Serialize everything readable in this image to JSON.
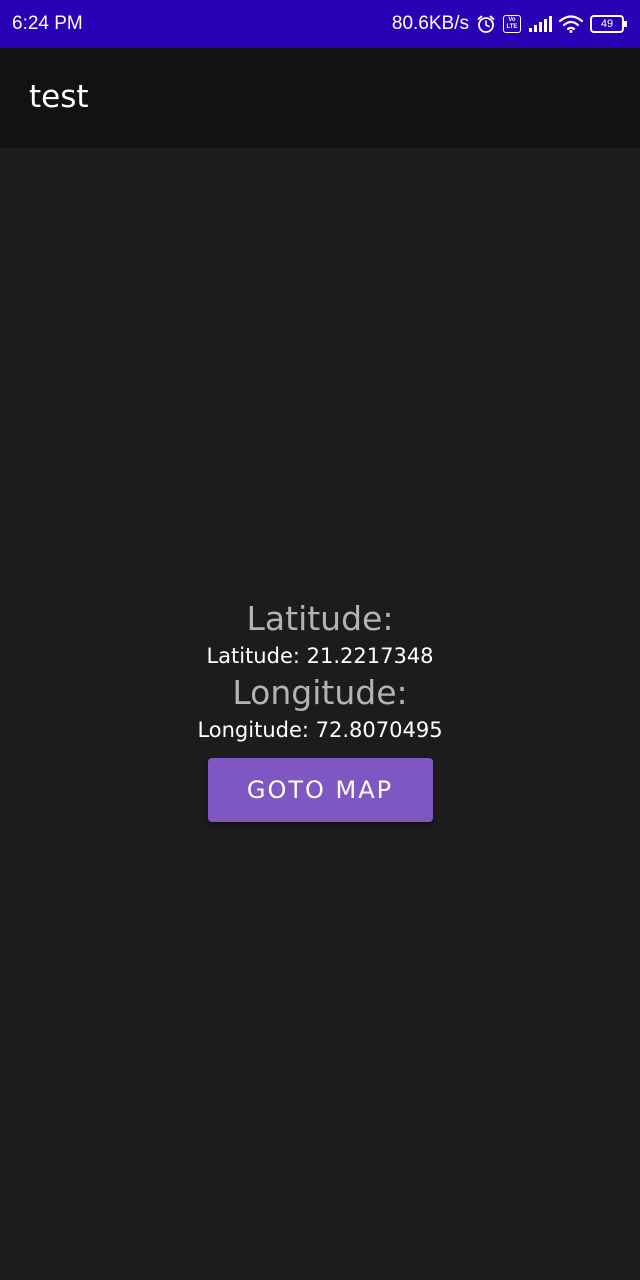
{
  "status_bar": {
    "time": "6:24 PM",
    "network_speed": "80.6KB/s",
    "volte_top": "Vo",
    "volte_bottom": "LTE",
    "battery_level": "49",
    "icons": [
      "alarm-icon",
      "volte-icon",
      "signal-icon",
      "wifi-icon",
      "battery-icon"
    ]
  },
  "app_bar": {
    "title": "test"
  },
  "main": {
    "latitude_heading": "Latitude:",
    "latitude_value": "Latitude: 21.2217348",
    "longitude_heading": "Longitude:",
    "longitude_value": "Longitude: 72.8070495",
    "goto_button_label": "GOTO MAP"
  },
  "colors": {
    "status_bar": "#2a00b4",
    "app_bar": "#121212",
    "background": "#1c1c1c",
    "button": "#7e57c2",
    "heading_text": "#b3b3b3",
    "value_text": "#ffffff"
  }
}
